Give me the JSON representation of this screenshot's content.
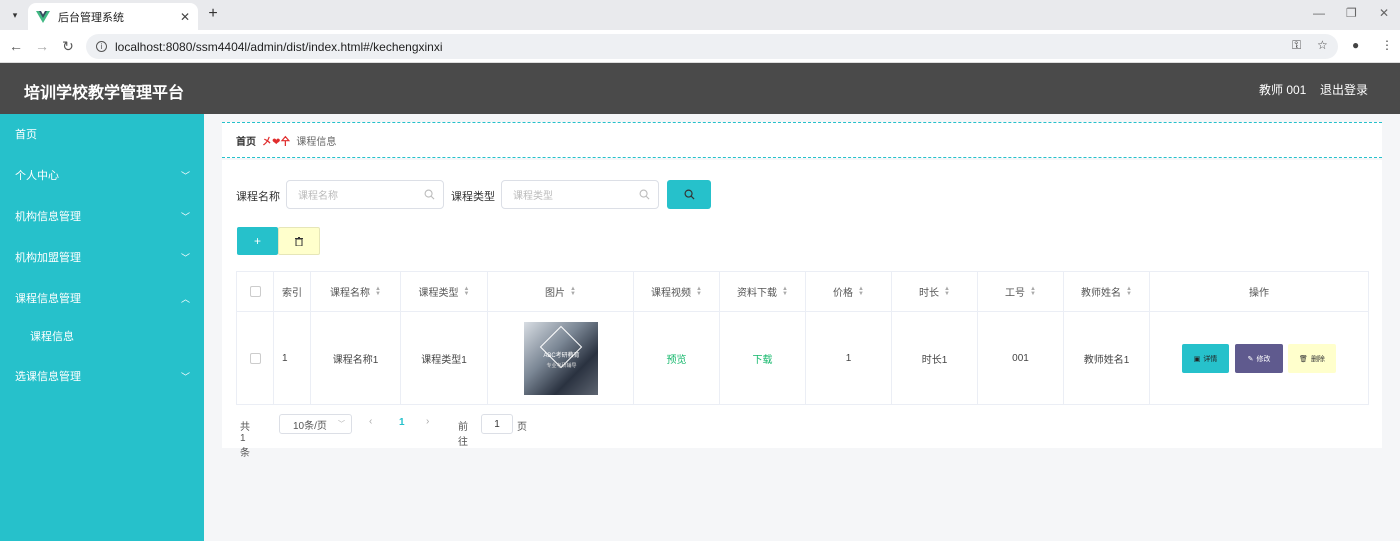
{
  "browser": {
    "tab_title": "后台管理系统",
    "url": "localhost:8080/ssm4404l/admin/dist/index.html#/kechengxinxi"
  },
  "header": {
    "title": "培训学校教学管理平台",
    "user": "教师 001",
    "logout": "退出登录"
  },
  "sidebar": {
    "items": [
      {
        "label": "首页"
      },
      {
        "label": "个人中心"
      },
      {
        "label": "机构信息管理"
      },
      {
        "label": "机构加盟管理"
      },
      {
        "label": "课程信息管理"
      },
      {
        "label": "课程信息"
      },
      {
        "label": "选课信息管理"
      }
    ]
  },
  "breadcrumb": {
    "home": "首页",
    "separator": "㐅❤㐃",
    "current": "课程信息"
  },
  "search": {
    "name_label": "课程名称",
    "name_placeholder": "课程名称",
    "type_label": "课程类型",
    "type_placeholder": "课程类型"
  },
  "toolbar": {
    "add_label": "+",
    "delete_icon": "trash-icon"
  },
  "table": {
    "headers": [
      "",
      "索引",
      "课程名称",
      "课程类型",
      "图片",
      "课程视频",
      "资料下载",
      "价格",
      "时长",
      "工号",
      "教师姓名",
      "操作"
    ],
    "row": {
      "index": "1",
      "name": "课程名称1",
      "type": "课程类型1",
      "image_title": "ABC考研教育",
      "image_sub": "专业考研辅导",
      "video": "预览",
      "download": "下载",
      "price": "1",
      "duration": "时长1",
      "job_no": "001",
      "teacher": "教师姓名1"
    },
    "actions": {
      "detail": "详情",
      "edit": "修改",
      "delete": "删除"
    }
  },
  "pagination": {
    "total": "共 1 条",
    "page_size": "10条/页",
    "current": "1",
    "goto_label": "前往",
    "goto_value": "1",
    "page_label": "页"
  },
  "colors": {
    "primary": "#26c1cb",
    "header_bg": "#4a4a4a",
    "edit_btn": "#5f5a8e",
    "delete_btn": "#ffffcc",
    "link": "#12b76a"
  }
}
